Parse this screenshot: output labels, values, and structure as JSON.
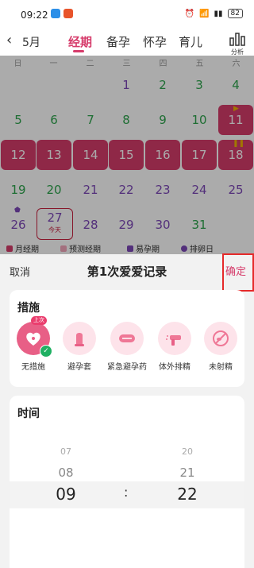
{
  "status_bar": {
    "time": "09:22",
    "battery": "82"
  },
  "nav": {
    "month": "5月",
    "tabs": [
      "经期",
      "备孕",
      "怀孕",
      "育儿"
    ],
    "analysis": "分析"
  },
  "weekdays": [
    "日",
    "一",
    "二",
    "三",
    "四",
    "五",
    "六"
  ],
  "calendar": {
    "today_sub": "今天",
    "days": [
      "1",
      "2",
      "3",
      "4",
      "5",
      "6",
      "7",
      "8",
      "9",
      "10",
      "11",
      "12",
      "13",
      "14",
      "15",
      "16",
      "17",
      "18",
      "19",
      "20",
      "21",
      "22",
      "23",
      "24",
      "25",
      "26",
      "27",
      "28",
      "29",
      "30",
      "31"
    ]
  },
  "legend": [
    "月经期",
    "预测经期",
    "易孕期",
    "排卵日"
  ],
  "sheet": {
    "cancel": "取消",
    "title": "第1次爱爱记录",
    "confirm": "确定",
    "measures_title": "措施",
    "last_badge": "上次",
    "measures": [
      "无措施",
      "避孕套",
      "紧急避孕药",
      "体外排精",
      "未射精"
    ],
    "time_title": "时间",
    "hours": [
      "07",
      "08",
      "09"
    ],
    "minutes": [
      "20",
      "21",
      "22"
    ],
    "colon": ":"
  },
  "colors": {
    "accent": "#d63c6b",
    "period": "#d63c6b",
    "fertile": "#7d48b8",
    "safe": "#2ea54d"
  }
}
